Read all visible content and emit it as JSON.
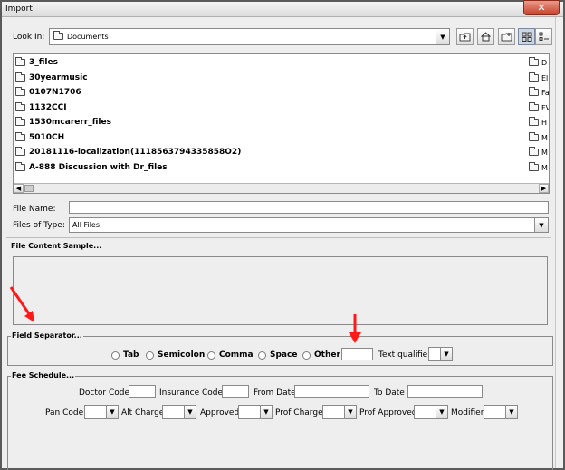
{
  "window": {
    "title": "Import",
    "close_glyph": "✕"
  },
  "lookin": {
    "label": "Look In:",
    "value": "Documents",
    "dropdown_glyph": "▼"
  },
  "toolbar": {
    "buttons": [
      {
        "name": "up-folder-icon"
      },
      {
        "name": "home-icon"
      },
      {
        "name": "new-folder-icon"
      },
      {
        "name": "list-view-icon"
      },
      {
        "name": "details-view-icon"
      }
    ]
  },
  "file_list": {
    "items": [
      "3_files",
      "30yearmusic",
      "0107N1706",
      "1132CCI",
      "1530mcarerr_files",
      "5010CH",
      "20181116-localization(1118563794335858O2)",
      "A-888 Discussion with Dr_files"
    ],
    "right_column": [
      "D",
      "El",
      "Fa",
      "FV",
      "H",
      "M",
      "M",
      "M"
    ],
    "scroll_left": "◀",
    "scroll_right": "▶"
  },
  "file_name": {
    "label": "File Name:",
    "value": ""
  },
  "files_of_type": {
    "label": "Files of Type:",
    "value": "All Files"
  },
  "file_content_sample": {
    "title": "File Content Sample..."
  },
  "field_separator": {
    "title": "Field Separator...",
    "options": [
      "Tab",
      "Semicolon",
      "Comma",
      "Space",
      "Other"
    ],
    "other_value": "",
    "text_qualifier_label": "Text qualifier"
  },
  "fee_schedule": {
    "title": "Fee Schedule...",
    "row1": [
      "Doctor Code",
      "Insurance Code",
      "From Date",
      "To Date"
    ],
    "row2": [
      "Pan Code",
      "Alt Charge",
      "Approved",
      "Prof Charge",
      "Prof Approved",
      "Modifier"
    ]
  },
  "colors": {
    "annotation_arrow": "#ff1a1a",
    "close_button": "#c7432c"
  }
}
